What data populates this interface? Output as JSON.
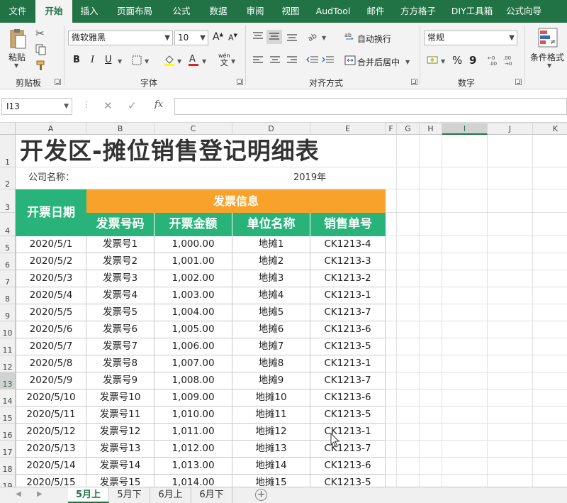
{
  "ribbon_tabs": [
    {
      "label": "文件",
      "active": false
    },
    {
      "label": "开始",
      "active": true
    },
    {
      "label": "插入",
      "active": false
    },
    {
      "label": "页面布局",
      "active": false
    },
    {
      "label": "公式",
      "active": false
    },
    {
      "label": "数据",
      "active": false
    },
    {
      "label": "审阅",
      "active": false
    },
    {
      "label": "视图",
      "active": false
    },
    {
      "label": "AudTool",
      "active": false
    },
    {
      "label": "邮件",
      "active": false
    },
    {
      "label": "方方格子",
      "active": false
    },
    {
      "label": "DIY工具箱",
      "active": false
    },
    {
      "label": "公式向导",
      "active": false
    }
  ],
  "ribbon": {
    "clipboard": {
      "paste_label": "粘贴",
      "group_label": "剪贴板"
    },
    "font": {
      "font_name": "微软雅黑",
      "font_size": "10",
      "group_label": "字体",
      "bold": "B",
      "italic": "I",
      "underline": "U",
      "phonetic": "wén",
      "phonetic_glyph": "文"
    },
    "alignment": {
      "wrap_text": "自动换行",
      "merge_center": "合并后居中",
      "group_label": "对齐方式"
    },
    "number": {
      "format": "常规",
      "percent": "%",
      "comma": "9",
      "group_label": "数字"
    },
    "styles": {
      "conditional_format": "条件格式"
    }
  },
  "formula_bar": {
    "name_box": "I13",
    "fx": "fx",
    "value": ""
  },
  "sheet": {
    "title": "开发区-摊位销售登记明细表",
    "company_label": "公司名称：",
    "year": "2019年",
    "header_date": "开票日期",
    "header_group": "发票信息",
    "headers": [
      "发票号码",
      "开票金额",
      "单位名称",
      "销售单号"
    ],
    "columns": [
      "A",
      "B",
      "C",
      "D",
      "E",
      "F",
      "G",
      "H",
      "I",
      "J",
      "K"
    ],
    "selected_column": "I",
    "row_numbers": [
      "1",
      "2",
      "3",
      "4",
      "5",
      "6",
      "7",
      "8",
      "9",
      "10",
      "11",
      "12",
      "13",
      "14",
      "15",
      "16",
      "17",
      "18",
      "19"
    ],
    "selected_row": "13",
    "rows": [
      [
        "2020/5/1",
        "发票号1",
        "1,000.00",
        "地摊1",
        "CK1213-4"
      ],
      [
        "2020/5/2",
        "发票号2",
        "1,001.00",
        "地摊2",
        "CK1213-3"
      ],
      [
        "2020/5/3",
        "发票号3",
        "1,002.00",
        "地摊3",
        "CK1213-2"
      ],
      [
        "2020/5/4",
        "发票号4",
        "1,003.00",
        "地摊4",
        "CK1213-1"
      ],
      [
        "2020/5/5",
        "发票号5",
        "1,004.00",
        "地摊5",
        "CK1213-7"
      ],
      [
        "2020/5/6",
        "发票号6",
        "1,005.00",
        "地摊6",
        "CK1213-6"
      ],
      [
        "2020/5/7",
        "发票号7",
        "1,006.00",
        "地摊7",
        "CK1213-5"
      ],
      [
        "2020/5/8",
        "发票号8",
        "1,007.00",
        "地摊8",
        "CK1213-1"
      ],
      [
        "2020/5/9",
        "发票号9",
        "1,008.00",
        "地摊9",
        "CK1213-7"
      ],
      [
        "2020/5/10",
        "发票号10",
        "1,009.00",
        "地摊10",
        "CK1213-6"
      ],
      [
        "2020/5/11",
        "发票号11",
        "1,010.00",
        "地摊11",
        "CK1213-5"
      ],
      [
        "2020/5/12",
        "发票号12",
        "1,011.00",
        "地摊12",
        "CK1213-1"
      ],
      [
        "2020/5/13",
        "发票号13",
        "1,012.00",
        "地摊13",
        "CK1213-7"
      ],
      [
        "2020/5/14",
        "发票号14",
        "1,013.00",
        "地摊14",
        "CK1213-6"
      ],
      [
        "2020/5/15",
        "发票号15",
        "1,014.00",
        "地摊15",
        "CK1213-5"
      ]
    ]
  },
  "sheet_tabs": [
    {
      "label": "5月上",
      "active": true
    },
    {
      "label": "5月下",
      "active": false
    },
    {
      "label": "6月上",
      "active": false
    },
    {
      "label": "6月下",
      "active": false
    }
  ],
  "colors": {
    "excel_green": "#217346",
    "header_green": "#27b37a",
    "header_orange": "#f8a22b"
  }
}
